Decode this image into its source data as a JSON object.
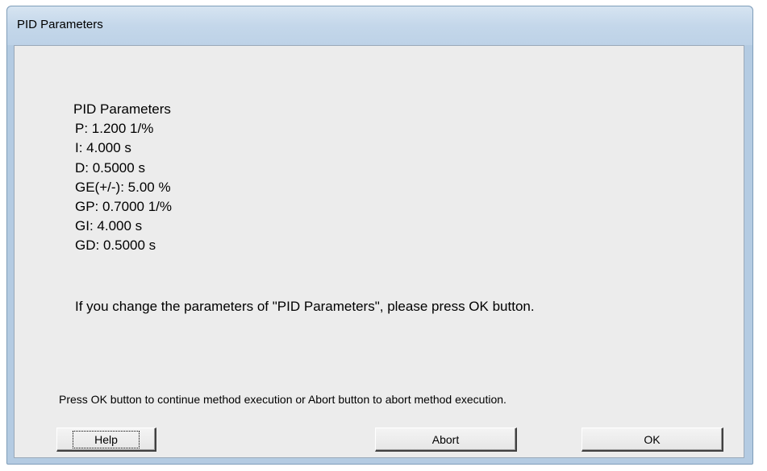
{
  "window": {
    "title": "PID Parameters"
  },
  "params": {
    "heading": "PID Parameters",
    "lines": [
      "P: 1.200 1/%",
      "I: 4.000 s",
      "D: 0.5000 s",
      "GE(+/-): 5.00 %",
      "GP: 0.7000 1/%",
      "GI: 4.000 s",
      "GD: 0.5000 s"
    ]
  },
  "message": "If you change the parameters of \"PID Parameters\", please press OK button.",
  "instructions": "Press OK button to continue method execution or Abort button to abort method execution.",
  "buttons": {
    "help": "Help",
    "abort": "Abort",
    "ok": "OK"
  }
}
